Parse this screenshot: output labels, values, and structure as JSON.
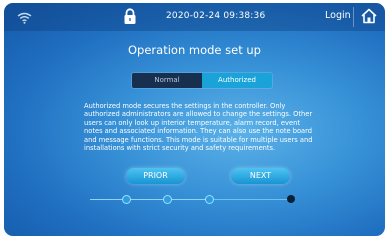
{
  "status_bar": {
    "datetime": "2020-02-24 09:38:36",
    "login_label": "Login",
    "icons": [
      "wifi-icon",
      "lock-icon",
      "home-icon"
    ]
  },
  "page": {
    "title": "Operation mode set up"
  },
  "mode_toggle": {
    "options": [
      "Normal",
      "Authorized"
    ],
    "selected": "Authorized"
  },
  "description": "Authorized mode secures the settings in the controller. Only authorized administrators are allowed to change the settings. Other users can only look up interior temperature, alarm record, event notes and associated information. They can also use the note board and message functions. This mode is suitable for multiple users and installations with strict security and safety requirements.",
  "navigation": {
    "prior_label": "PRIOR",
    "next_label": "NEXT"
  },
  "progress": {
    "total_steps": 4,
    "current_step": 4
  },
  "colors": {
    "accent": "#1aa3d8",
    "background": "#2b86d2",
    "inactive_toggle": "#17304f"
  }
}
